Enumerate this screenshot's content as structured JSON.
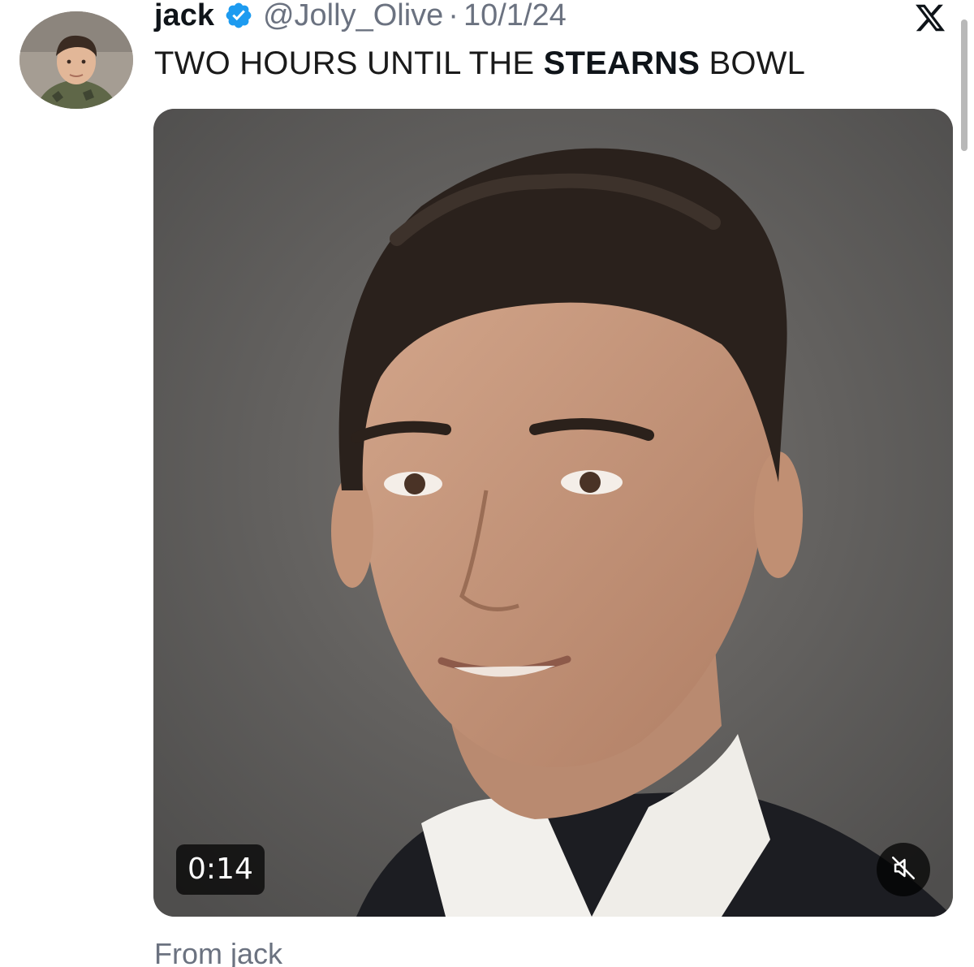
{
  "tweet": {
    "author_name": "jack",
    "handle": "@Jolly_Olive",
    "separator": "·",
    "date": "10/1/24",
    "text_before": "TWO HOURS UNTIL THE ",
    "text_bold": "STEARNS",
    "text_after": " BOWL",
    "verified_icon": "verified-badge-icon",
    "brand_icon": "x-logo-icon"
  },
  "media": {
    "type": "video",
    "duration": "0:14",
    "mute_icon": "muted-speaker-icon"
  },
  "footer": {
    "from_text": "From jack"
  },
  "colors": {
    "verified_blue": "#1d9bf0",
    "secondary_text": "#6b7280"
  }
}
